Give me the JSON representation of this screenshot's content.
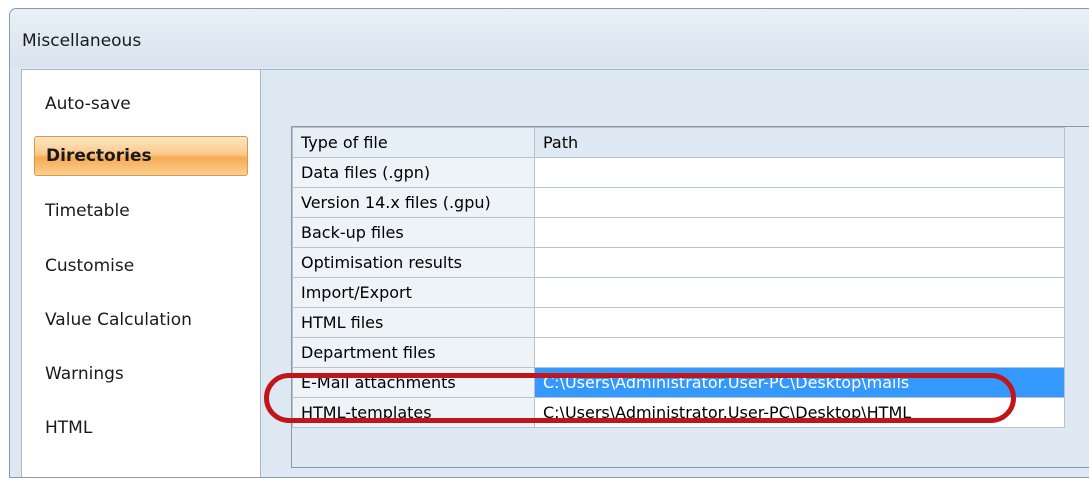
{
  "window": {
    "title": "Miscellaneous"
  },
  "sidebar": {
    "items": [
      {
        "label": "Auto-save",
        "selected": false
      },
      {
        "label": "Directories",
        "selected": true
      },
      {
        "label": "Timetable",
        "selected": false
      },
      {
        "label": "Customise",
        "selected": false
      },
      {
        "label": "Value Calculation",
        "selected": false
      },
      {
        "label": "Warnings",
        "selected": false
      },
      {
        "label": "HTML",
        "selected": false
      }
    ]
  },
  "grid": {
    "headers": [
      "Type of file",
      "Path"
    ],
    "rows": [
      {
        "type": "Data files (.gpn)",
        "path": ""
      },
      {
        "type": "Version 14.x files (.gpu)",
        "path": ""
      },
      {
        "type": "Back-up files",
        "path": ""
      },
      {
        "type": "Optimisation results",
        "path": ""
      },
      {
        "type": "Import/Export",
        "path": ""
      },
      {
        "type": "HTML files",
        "path": ""
      },
      {
        "type": "Department files",
        "path": ""
      },
      {
        "type": "E-Mail attachments",
        "path": "C:\\Users\\Administrator.User-PC\\Desktop\\mails"
      },
      {
        "type": "HTML-templates",
        "path": "C:\\Users\\Administrator.User-PC\\Desktop\\HTML"
      }
    ],
    "selected_row": "E-Mail attachments"
  },
  "colors": {
    "selection": "#3399ff",
    "highlight_ring": "#c0161b",
    "nav_selected": "#f6ab55"
  }
}
